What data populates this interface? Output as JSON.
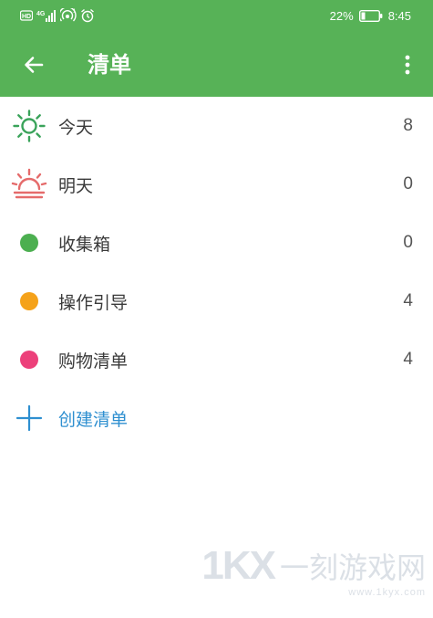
{
  "status_bar": {
    "left_icons": [
      "hd-icon",
      "4g-signal-icon",
      "hotspot-icon",
      "alarm-icon"
    ],
    "battery_percent": "22%",
    "battery_level": 0.22,
    "time": "8:45"
  },
  "app_bar": {
    "title": "清单",
    "color": "#57b257"
  },
  "lists": [
    {
      "label": "今天",
      "count": "8",
      "icon": "sun-icon",
      "color": "#3aa35a"
    },
    {
      "label": "明天",
      "count": "0",
      "icon": "sunrise-icon",
      "color": "#e56b6b"
    },
    {
      "label": "收集箱",
      "count": "0",
      "icon": "dot-icon",
      "color": "#4caf50"
    },
    {
      "label": "操作引导",
      "count": "4",
      "icon": "dot-icon",
      "color": "#f5a21a"
    },
    {
      "label": "购物清单",
      "count": "4",
      "icon": "dot-icon",
      "color": "#ec407a"
    }
  ],
  "create_list": {
    "label": "创建清单",
    "color": "#2e8fd0"
  },
  "watermark": {
    "logo": "1KX",
    "text": "一刻游戏网",
    "url": "www.1kyx.com"
  }
}
